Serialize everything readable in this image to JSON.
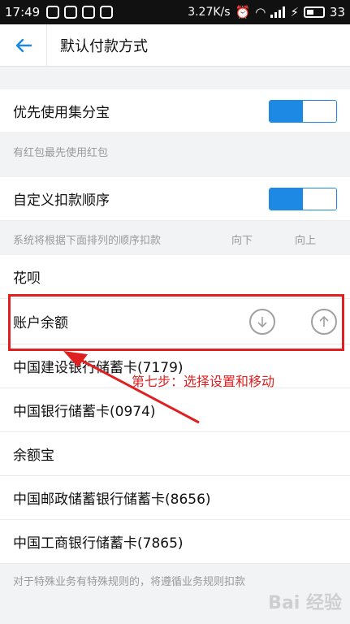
{
  "status_bar": {
    "time": "17:49",
    "net_speed": "3.27K/s",
    "battery": "33"
  },
  "header": {
    "title": "默认付款方式"
  },
  "priority": {
    "label": "优先使用集分宝",
    "hint": "有红包最先使用红包",
    "enabled": true
  },
  "custom_order": {
    "label": "自定义扣款顺序",
    "hint": "系统将根据下面排列的顺序扣款",
    "col_down": "向下",
    "col_up": "向上",
    "enabled": true
  },
  "methods": [
    {
      "label": "花呗"
    },
    {
      "label": "账户余额"
    },
    {
      "label": "中国建设银行储蓄卡(7179)"
    },
    {
      "label": "中国银行储蓄卡(0974)"
    },
    {
      "label": "余额宝"
    },
    {
      "label": "中国邮政储蓄银行储蓄卡(8656)"
    },
    {
      "label": "中国工商银行储蓄卡(7865)"
    }
  ],
  "footer_note": "对于特殊业务有特殊规则的，将遵循业务规则扣款",
  "annotation": {
    "text": "第七步：选择设置和移动"
  },
  "watermark": "Bai 经验",
  "colors": {
    "accent": "#1e88e5",
    "annotation": "#e02020"
  }
}
